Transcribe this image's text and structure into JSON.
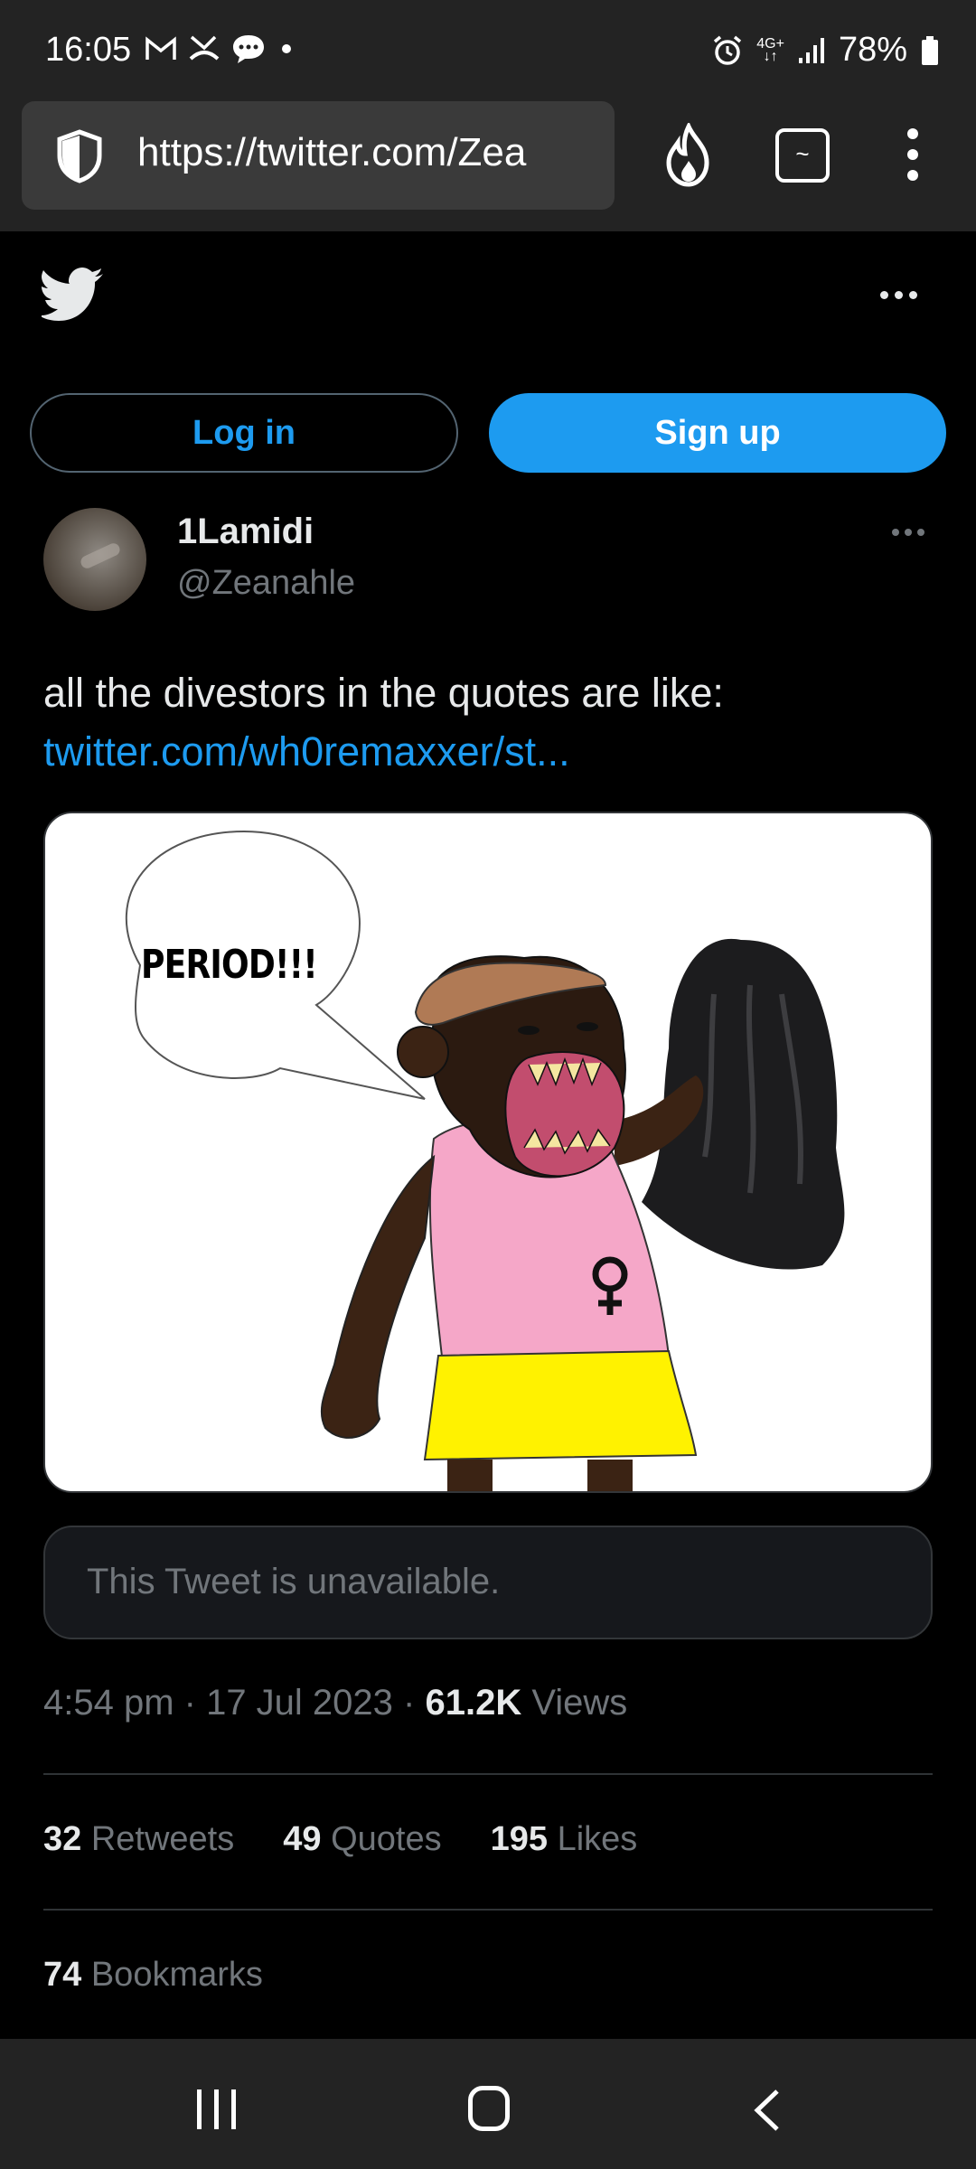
{
  "status_bar": {
    "time": "16:05",
    "network": "4G+",
    "battery": "78%",
    "left_icons": [
      "gmail-icon",
      "missed-call-icon",
      "chat-icon",
      "dot-icon"
    ],
    "right_icons": [
      "alarm-icon",
      "signal-icon",
      "battery-icon"
    ]
  },
  "browser": {
    "url": "https://twitter.com/Zea",
    "icons": [
      "shield-icon",
      "fire-icon",
      "tabs-icon",
      "menu-icon"
    ],
    "tabs_glyph": "~"
  },
  "header": {
    "logo": "twitter-bird-icon",
    "login_label": "Log in",
    "signup_label": "Sign up"
  },
  "tweet": {
    "author_name": "1Lamidi",
    "author_handle": "@Zeanahle",
    "text": "all the divestors in the quotes are like:",
    "link_text": "twitter.com/wh0remaxxer/st...",
    "image_caption_text": "PERIOD!!!",
    "quoted_unavailable": "This Tweet is unavailable.",
    "timestamp": "4:54 pm · 17 Jul 2023 · ",
    "views_count": "61.2K",
    "views_label": " Views"
  },
  "stats": {
    "retweets_count": "32",
    "retweets_label": " Retweets",
    "quotes_count": "49",
    "quotes_label": " Quotes",
    "likes_count": "195",
    "likes_label": " Likes",
    "bookmarks_count": "74",
    "bookmarks_label": " Bookmarks"
  },
  "colors": {
    "accent": "#1d9bf0",
    "background": "#000000",
    "muted_text": "#71767b"
  }
}
